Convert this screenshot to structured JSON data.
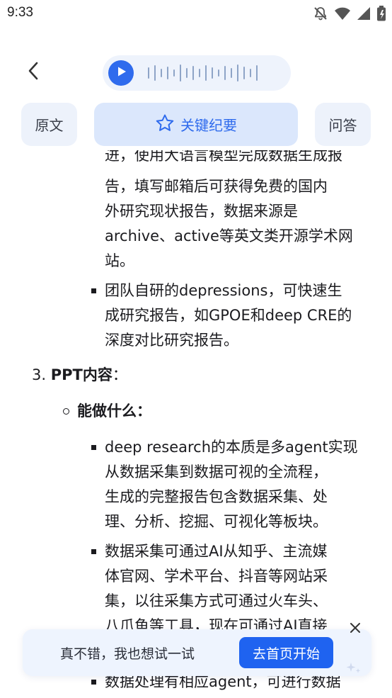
{
  "status_bar": {
    "time": "9:33",
    "icons": [
      "notifications-off-icon",
      "wifi-icon",
      "signal-icon",
      "battery-icon"
    ]
  },
  "header": {
    "back_icon": "chevron-left-icon",
    "audio": {
      "play_icon": "play-icon",
      "waveform_icon": "waveform-icon"
    }
  },
  "tabs": [
    {
      "label": "原文",
      "active": false
    },
    {
      "label": "关键纪要",
      "active": true,
      "icon": "star-icon"
    },
    {
      "label": "问答",
      "active": false
    }
  ],
  "content": {
    "partial_line": "进，使用大语言模型完成数据生成报",
    "item1_lines": [
      "告，填写邮箱后可获得免费的国内",
      "外研究现状报告，数据来源是",
      "archive、active等英文类开源学术网",
      "站。"
    ],
    "item2_lines": [
      "团队自研的depressions，可快速生",
      "成研究报告，如GPOE和deep CRE的",
      "深度对比研究报告。"
    ],
    "section3": {
      "number": "3.",
      "title": "PPT内容",
      "colon": "："
    },
    "subheading": "能做什么：",
    "item3_lines": [
      "deep research的本质是多agent实现",
      "从数据采集到数据可视的全流程，",
      "生成的完整报告包含数据采集、处",
      "理、分析、挖掘、可视化等板块。"
    ],
    "item4_lines": [
      "数据采集可通过AI从知乎、主流媒",
      "体官网、学术平台、抖音等网站采",
      "集，以往采集方式可通过火车头、",
      "八爪鱼等工具，现在可通过AI直接"
    ],
    "item5_line": "数据处理有相应agent，可进行数据"
  },
  "toast": {
    "text": "真不错，我也想试一试",
    "button": "去首页开始",
    "close_icon": "close-icon"
  },
  "colors": {
    "accent": "#2f6bed",
    "button": "#1f63f0",
    "tab_active_bg": "#dbe7fc",
    "tab_bg": "#edf2fb"
  }
}
